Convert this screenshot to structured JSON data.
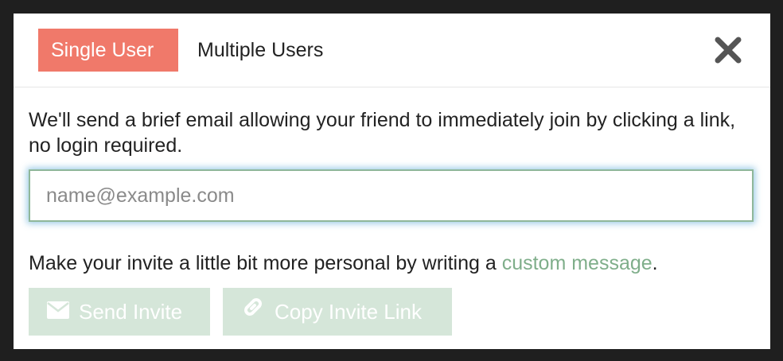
{
  "tabs": {
    "single": "Single User",
    "multiple": "Multiple Users"
  },
  "description": "We'll send a brief email allowing your friend to immediately join by clicking a link, no login required.",
  "email": {
    "placeholder": "name@example.com",
    "value": ""
  },
  "personal": {
    "prefix": "Make your invite a little bit more personal by writing a ",
    "link": "custom message",
    "suffix": "."
  },
  "buttons": {
    "send": "Send Invite",
    "copy": "Copy Invite Link"
  },
  "icons": {
    "close": "close-icon",
    "send": "envelope-icon",
    "copy": "link-icon"
  },
  "colors": {
    "active_tab": "#f0796a",
    "link": "#7fae8a",
    "button_bg": "#d5e6d9",
    "input_border": "#8fb79a"
  }
}
